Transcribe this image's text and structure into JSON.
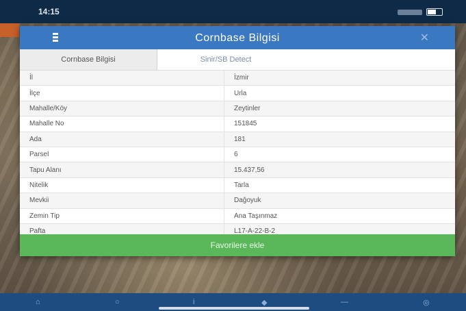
{
  "status": {
    "time": "14:15"
  },
  "dialog": {
    "title": "Cornbase Bilgisi",
    "close_glyph": "✕",
    "tabs": [
      {
        "label": "Cornbase Bilgisi",
        "active": true
      },
      {
        "label": "Sinir/SB Detect",
        "active": false
      }
    ],
    "rows": [
      {
        "key": "İl",
        "value": "İzmir"
      },
      {
        "key": "İlçe",
        "value": "Urla"
      },
      {
        "key": "Mahalle/Köy",
        "value": "Zeytinler"
      },
      {
        "key": "Mahalle No",
        "value": "151845"
      },
      {
        "key": "Ada",
        "value": "181"
      },
      {
        "key": "Parsel",
        "value": "6"
      },
      {
        "key": "Tapu Alanı",
        "value": "15.437,56"
      },
      {
        "key": "Nitelik",
        "value": "Tarla"
      },
      {
        "key": "Mevkii",
        "value": "Dağoyuk"
      },
      {
        "key": "Zemin Tip",
        "value": "Ana Taşınmaz"
      },
      {
        "key": "Pafta",
        "value": "L17-A-22-B-2"
      }
    ],
    "favorite_label": "Favorilere ekle"
  },
  "navbar": {
    "icons": [
      "home-icon",
      "search-icon",
      "info-icon",
      "layers-icon",
      "minus-icon",
      "location-icon"
    ]
  },
  "colors": {
    "header": "#3b78c2",
    "button": "#5bb85a",
    "navbar": "#1d4c80"
  }
}
